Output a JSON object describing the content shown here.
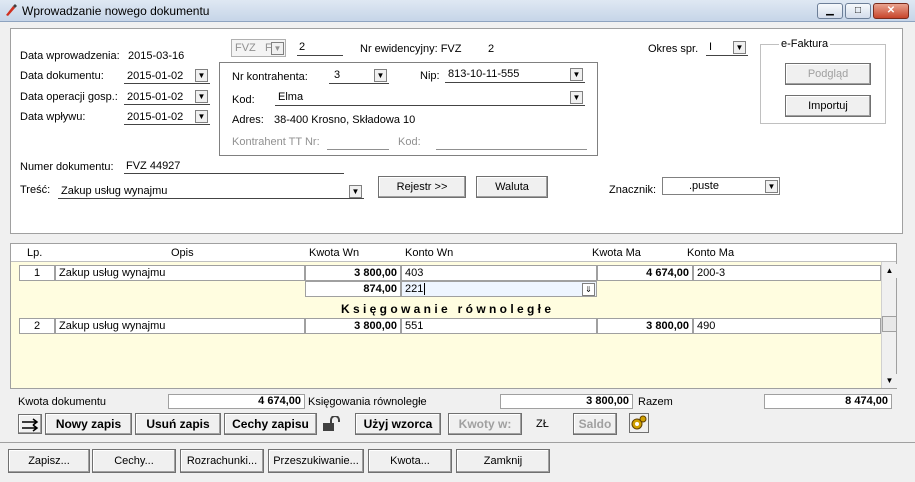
{
  "window": {
    "title": "Wprowadzanie nowego dokumentu",
    "min": "▁",
    "max": "□",
    "close": "✕"
  },
  "header": {
    "data_wprowadzenia_label": "Data wprowadzenia:",
    "data_wprowadzenia": "2015-03-16",
    "data_dokumentu_label": "Data dokumentu:",
    "data_dokumentu": "2015-01-02",
    "data_operacji_label": "Data operacji gosp.:",
    "data_operacji": "2015-01-02",
    "data_wplywu_label": "Data wpływu:",
    "data_wplywu": "2015-01-02",
    "typ": "FVZ",
    "typ_short": "F",
    "nr": "2",
    "nr_ewid_label": "Nr ewidencyjny: FVZ",
    "nr_ewid_value": "2",
    "okres_label": "Okres spr.",
    "okres_value": "I",
    "numer_label": "Numer dokumentu:",
    "numer_value": "FVZ 44927",
    "tresc_label": "Treść:",
    "tresc_value": "Zakup usług wynajmu",
    "rejestr_button": "Rejestr >>",
    "waluta_button": "Waluta",
    "znacznik_label": "Znacznik:",
    "znacznik_value": ".puste"
  },
  "kontrahent": {
    "nr_label": "Nr kontrahenta:",
    "nr_value": "3",
    "nip_label": "Nip:",
    "nip_value": "813-10-11-555",
    "kod_label": "Kod:",
    "kod_value": "Elma",
    "adres_label": "Adres:",
    "adres_value": "38-400 Krosno, Składowa 10",
    "tt_label": "Kontrahent TT Nr:",
    "tt_kod_label": "Kod:"
  },
  "efaktura": {
    "label": "e-Faktura",
    "podglad": "Podgląd",
    "importuj": "Importuj"
  },
  "grid": {
    "headers": {
      "lp": "Lp.",
      "opis": "Opis",
      "kwota_wn": "Kwota Wn",
      "konto_wn": "Konto Wn",
      "kwota_ma": "Kwota Ma",
      "konto_ma": "Konto Ma"
    },
    "rows": [
      {
        "lp": "1",
        "opis": "Zakup usług wynajmu",
        "kwota_wn": "3 800,00",
        "konto_wn": "403",
        "kwota_ma": "4 674,00",
        "konto_ma": "200-3"
      },
      {
        "lp": "",
        "opis": "",
        "kwota_wn": "874,00",
        "konto_wn": "221",
        "kwota_ma": "",
        "konto_ma": ""
      },
      {
        "lp": "2",
        "opis": "Zakup usług wynajmu",
        "kwota_wn": "3 800,00",
        "konto_wn": "551",
        "kwota_ma": "3 800,00",
        "konto_ma": "490"
      }
    ],
    "section_title": "K s i ę g o w a n i e   r ó w n o l e g ł e"
  },
  "summary": {
    "kwota_dok_label": "Kwota dokumentu",
    "kwota_dok": "4 674,00",
    "ksieg_label": "Księgowania równoległe",
    "ksieg_value": "3 800,00",
    "razem_label": "Razem",
    "razem_value": "8 474,00"
  },
  "toolbar": {
    "nowy": "Nowy zapis",
    "usun": "Usuń zapis",
    "cechy_zapisu": "Cechy zapisu",
    "uzyj": "Użyj wzorca",
    "kwoty": "Kwoty w:",
    "zl": "ZŁ",
    "saldo": "Saldo"
  },
  "footer": {
    "zapisz": "Zapisz...",
    "cechy": "Cechy...",
    "rozrachunki": "Rozrachunki...",
    "przeszukiwanie": "Przeszukiwanie...",
    "kwota": "Kwota...",
    "zamknij": "Zamknij"
  }
}
